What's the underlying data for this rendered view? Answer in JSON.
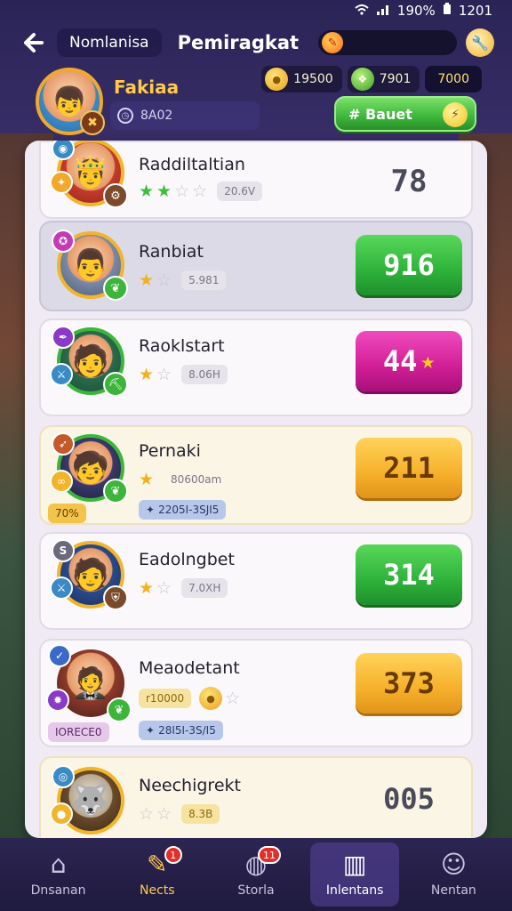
{
  "status": {
    "wifi": "wifi-icon",
    "signal": "signal-icon",
    "battery": "190%",
    "time": "1201"
  },
  "header": {
    "nav_label": "Nomlanisa",
    "title": "Pemiragkat"
  },
  "profile": {
    "name": "Fakiaa",
    "code": "8A02",
    "currencies": [
      {
        "icon": "coin-icon",
        "value": "19500"
      },
      {
        "icon": "gem-icon",
        "value": "7901"
      },
      {
        "icon": "",
        "value": "7000"
      }
    ],
    "boost_label": "# Bauet"
  },
  "players": [
    {
      "name": "Raddiltaltian",
      "stars": [
        "green",
        "green",
        "off",
        "off"
      ],
      "stat": "20.6V",
      "score": "78",
      "score_style": "plain"
    },
    {
      "name": "Ranbiat",
      "stars": [
        "on",
        "off"
      ],
      "stat": "5.981",
      "score": "916",
      "score_style": "green"
    },
    {
      "name": "Raoklstart",
      "stars": [
        "on",
        "off"
      ],
      "stat": "8.06H",
      "score": "44",
      "score_style": "pink"
    },
    {
      "name": "Pernaki",
      "stars": [
        "on"
      ],
      "stat": "80600am",
      "tag": "2205I-3SJI5",
      "badge": "70%",
      "score": "211",
      "score_style": "orange"
    },
    {
      "name": "Eadolngbet",
      "stars": [
        "on",
        "off"
      ],
      "stat": "7.0XH",
      "score": "314",
      "score_style": "green"
    },
    {
      "name": "Meaodetant",
      "stars": [],
      "stat": "r10000",
      "tag": "28I5I-3S/I5",
      "badge": "IORECE0",
      "score": "373",
      "score_style": "orange"
    },
    {
      "name": "Neechigrekt",
      "stars": [
        "off",
        "off"
      ],
      "stat": "8.3B",
      "score": "005",
      "score_style": "plain"
    }
  ],
  "tabs": [
    {
      "label": "Dnsanan",
      "icon": "home-icon"
    },
    {
      "label": "Nects",
      "icon": "news-icon",
      "badge": "1"
    },
    {
      "label": "Storla",
      "icon": "compass-icon",
      "badge": "11"
    },
    {
      "label": "Inlentans",
      "icon": "grid-icon"
    },
    {
      "label": "Nentan",
      "icon": "profile-icon"
    }
  ]
}
